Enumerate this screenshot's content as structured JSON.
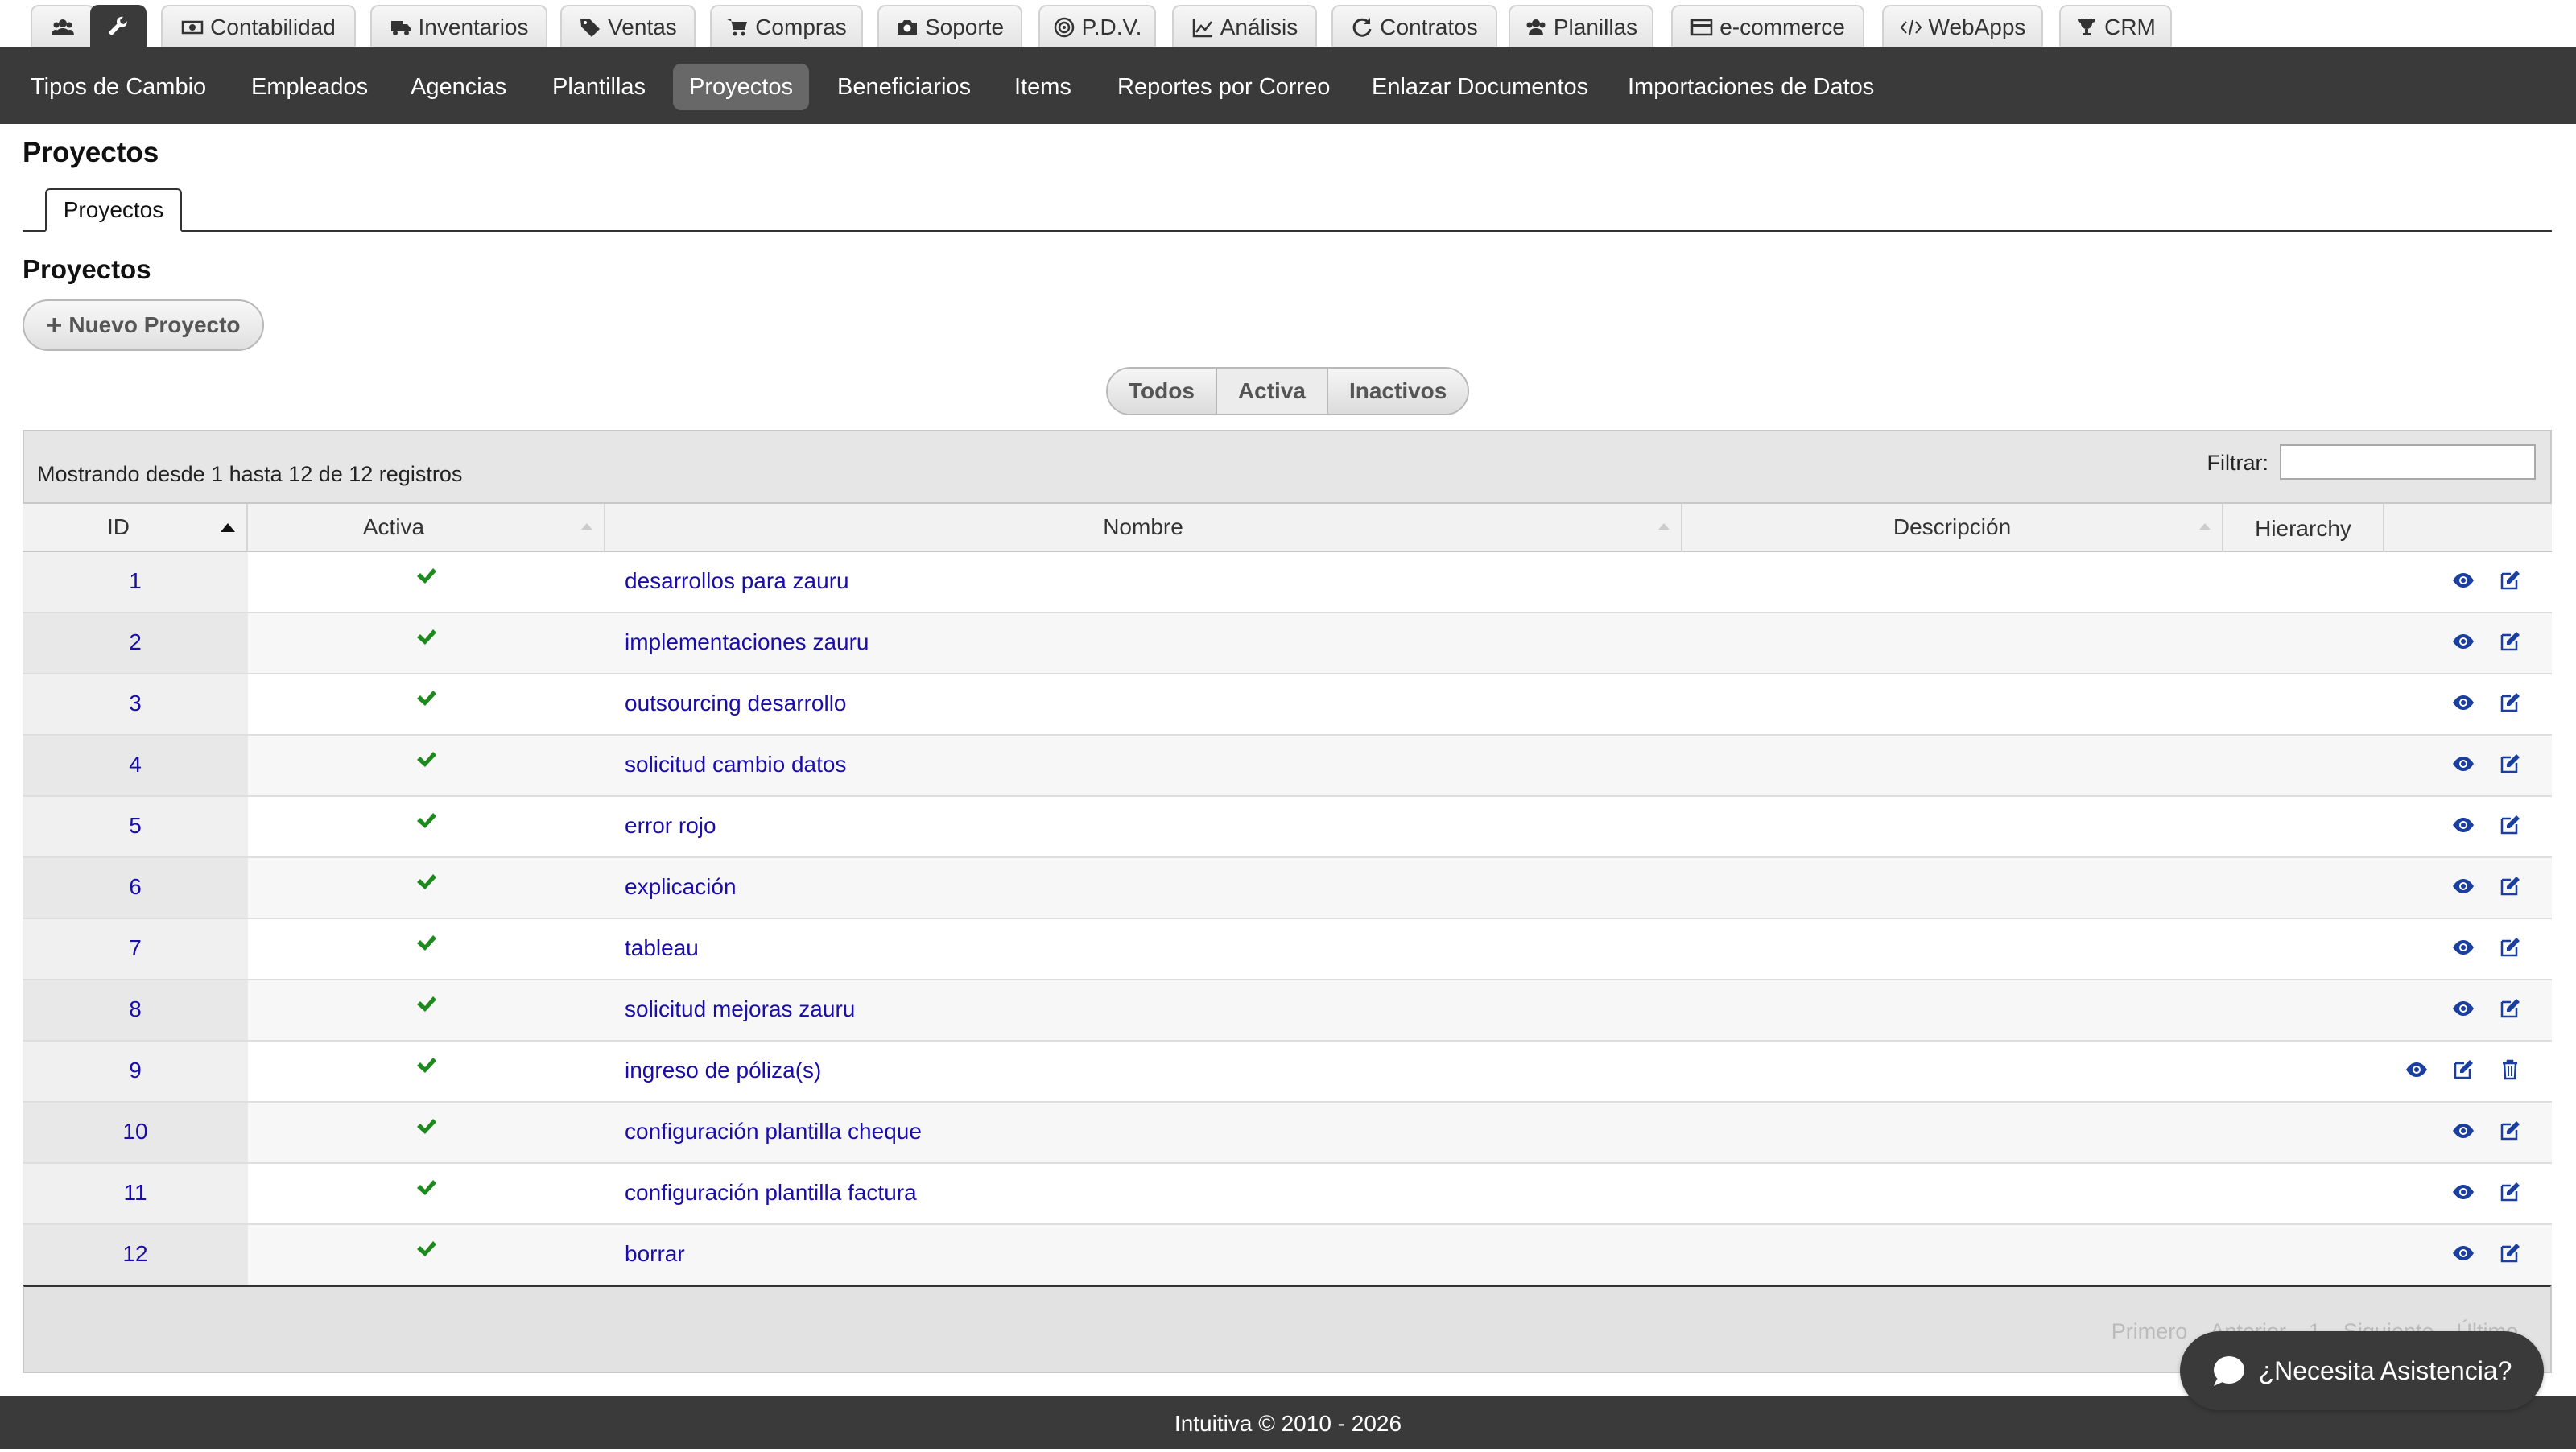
{
  "top_tabs": [
    {
      "label": "",
      "icon": "users-icon"
    },
    {
      "label": "",
      "icon": "wrench-icon"
    },
    {
      "label": "Contabilidad",
      "icon": "money-icon"
    },
    {
      "label": "Inventarios",
      "icon": "truck-icon"
    },
    {
      "label": "Ventas",
      "icon": "tag-icon"
    },
    {
      "label": "Compras",
      "icon": "cart-icon"
    },
    {
      "label": "Soporte",
      "icon": "camera-icon"
    },
    {
      "label": "P.D.V.",
      "icon": "target-icon"
    },
    {
      "label": "Análisis",
      "icon": "chart-icon"
    },
    {
      "label": "Contratos",
      "icon": "refresh-icon"
    },
    {
      "label": "Planillas",
      "icon": "users-icon"
    },
    {
      "label": "e-commerce",
      "icon": "credit-card-icon"
    },
    {
      "label": "WebApps",
      "icon": "code-icon"
    },
    {
      "label": "CRM",
      "icon": "trophy-icon"
    }
  ],
  "subnav": [
    "Tipos de Cambio",
    "Empleados",
    "Agencias",
    "Plantillas",
    "Proyectos",
    "Beneficiarios",
    "Items",
    "Reportes por Correo",
    "Enlazar Documentos",
    "Importaciones de Datos"
  ],
  "page_title": "Proyectos",
  "subtab_label": "Proyectos",
  "section_title": "Proyectos",
  "new_button": {
    "icon": "+",
    "label": "Nuevo Proyecto"
  },
  "filter_segments": [
    "Todos",
    "Activa",
    "Inactivos"
  ],
  "showing_text": "Mostrando desde 1 hasta 12 de 12 registros",
  "filter_label": "Filtrar:",
  "filter_value": "",
  "columns": [
    "ID",
    "Activa",
    "Nombre",
    "Descripción",
    "Hierarchy"
  ],
  "rows": [
    {
      "id": "1",
      "name": "desarrollos para zauru",
      "active": true,
      "delete": false
    },
    {
      "id": "2",
      "name": "implementaciones zauru",
      "active": true,
      "delete": false
    },
    {
      "id": "3",
      "name": "outsourcing desarrollo",
      "active": true,
      "delete": false
    },
    {
      "id": "4",
      "name": "solicitud cambio datos",
      "active": true,
      "delete": false
    },
    {
      "id": "5",
      "name": "error rojo",
      "active": true,
      "delete": false
    },
    {
      "id": "6",
      "name": "explicación",
      "active": true,
      "delete": false
    },
    {
      "id": "7",
      "name": "tableau",
      "active": true,
      "delete": false
    },
    {
      "id": "8",
      "name": "solicitud mejoras zauru",
      "active": true,
      "delete": false
    },
    {
      "id": "9",
      "name": "ingreso de póliza(s)",
      "active": true,
      "delete": true
    },
    {
      "id": "10",
      "name": "configuración plantilla cheque",
      "active": true,
      "delete": false
    },
    {
      "id": "11",
      "name": "configuración plantilla factura",
      "active": true,
      "delete": false
    },
    {
      "id": "12",
      "name": "borrar",
      "active": true,
      "delete": false
    }
  ],
  "pager": [
    "Primero",
    "Anterior",
    "1",
    "Siguiente",
    "Último"
  ],
  "footer_text": "Intuitiva © 2010 - 2026",
  "help_button": "¿Necesita Asistencia?",
  "colors": {
    "dark_bar": "#3a3a3a",
    "link": "#1a0dab",
    "check": "#1e8a1e",
    "icon_blue": "#1a3f9e"
  }
}
